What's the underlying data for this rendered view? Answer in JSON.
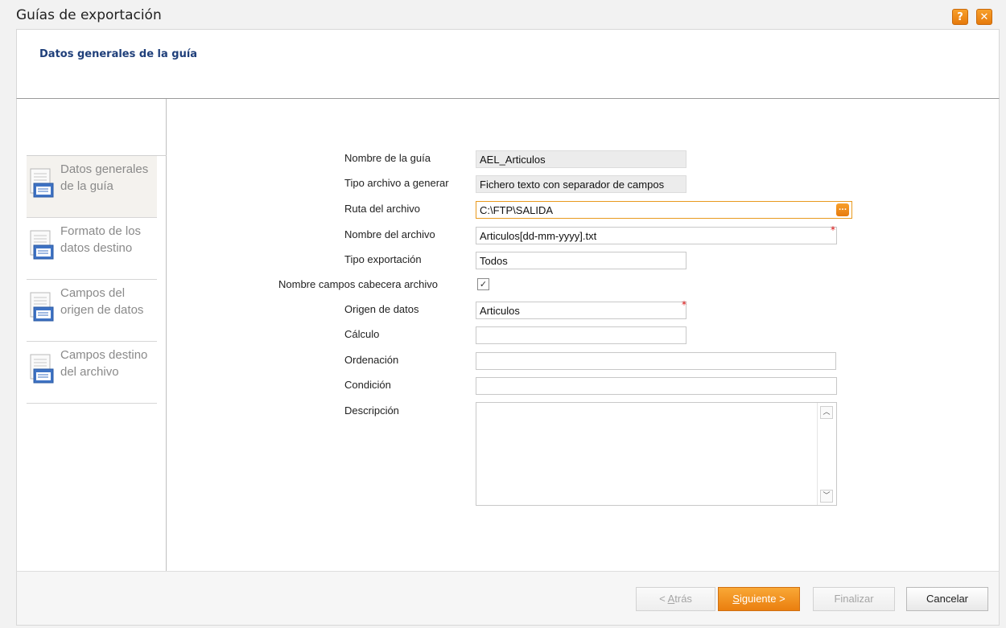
{
  "window": {
    "title": "Guías de exportación",
    "help_label": "?",
    "close_label": "✕"
  },
  "header": {
    "title": "Datos generales de la guía"
  },
  "nav": {
    "items": [
      {
        "label": "Datos generales de la guía",
        "active": true
      },
      {
        "label": "Formato de los datos destino",
        "active": false
      },
      {
        "label": "Campos del origen de datos",
        "active": false
      },
      {
        "label": "Campos destino del archivo",
        "active": false
      }
    ]
  },
  "form": {
    "nombre_guia": {
      "label": "Nombre de la guía",
      "value": "AEL_Articulos"
    },
    "tipo_archivo": {
      "label": "Tipo archivo a generar",
      "value": "Fichero texto con separador de campos"
    },
    "ruta_archivo": {
      "label": "Ruta del archivo",
      "value": "C:\\FTP\\SALIDA",
      "button_label": "..."
    },
    "nombre_archivo": {
      "label": "Nombre del archivo",
      "value": "Articulos[dd-mm-yyyy].txt",
      "required_mark": "*"
    },
    "tipo_exportacion": {
      "label": "Tipo exportación",
      "value": "Todos"
    },
    "nombre_campos_cabecera": {
      "label": "Nombre campos cabecera archivo",
      "checked": true,
      "check_glyph": "✓"
    },
    "origen_datos": {
      "label": "Origen de datos",
      "value": "Articulos",
      "required_mark": "*"
    },
    "calculo": {
      "label": "Cálculo",
      "value": ""
    },
    "ordenacion": {
      "label": "Ordenación",
      "value": ""
    },
    "condicion": {
      "label": "Condición",
      "value": ""
    },
    "descripcion": {
      "label": "Descripción",
      "value": "",
      "scroll_up": "︿",
      "scroll_down": "﹀"
    }
  },
  "footer": {
    "back": {
      "prefix": "< ",
      "underlined": "A",
      "rest": "trás"
    },
    "next": {
      "underlined": "S",
      "rest": "iguiente >"
    },
    "finish": "Finalizar",
    "cancel": "Cancelar"
  },
  "colors": {
    "accent_orange": "#ea7f0f",
    "header_title_blue": "#1f3f7a",
    "required_red": "#dd1111"
  },
  "icons": [
    "help-icon",
    "close-icon",
    "form-document-icon",
    "ellipsis-icon",
    "checkbox-check-icon",
    "scroll-up-icon",
    "scroll-down-icon"
  ]
}
